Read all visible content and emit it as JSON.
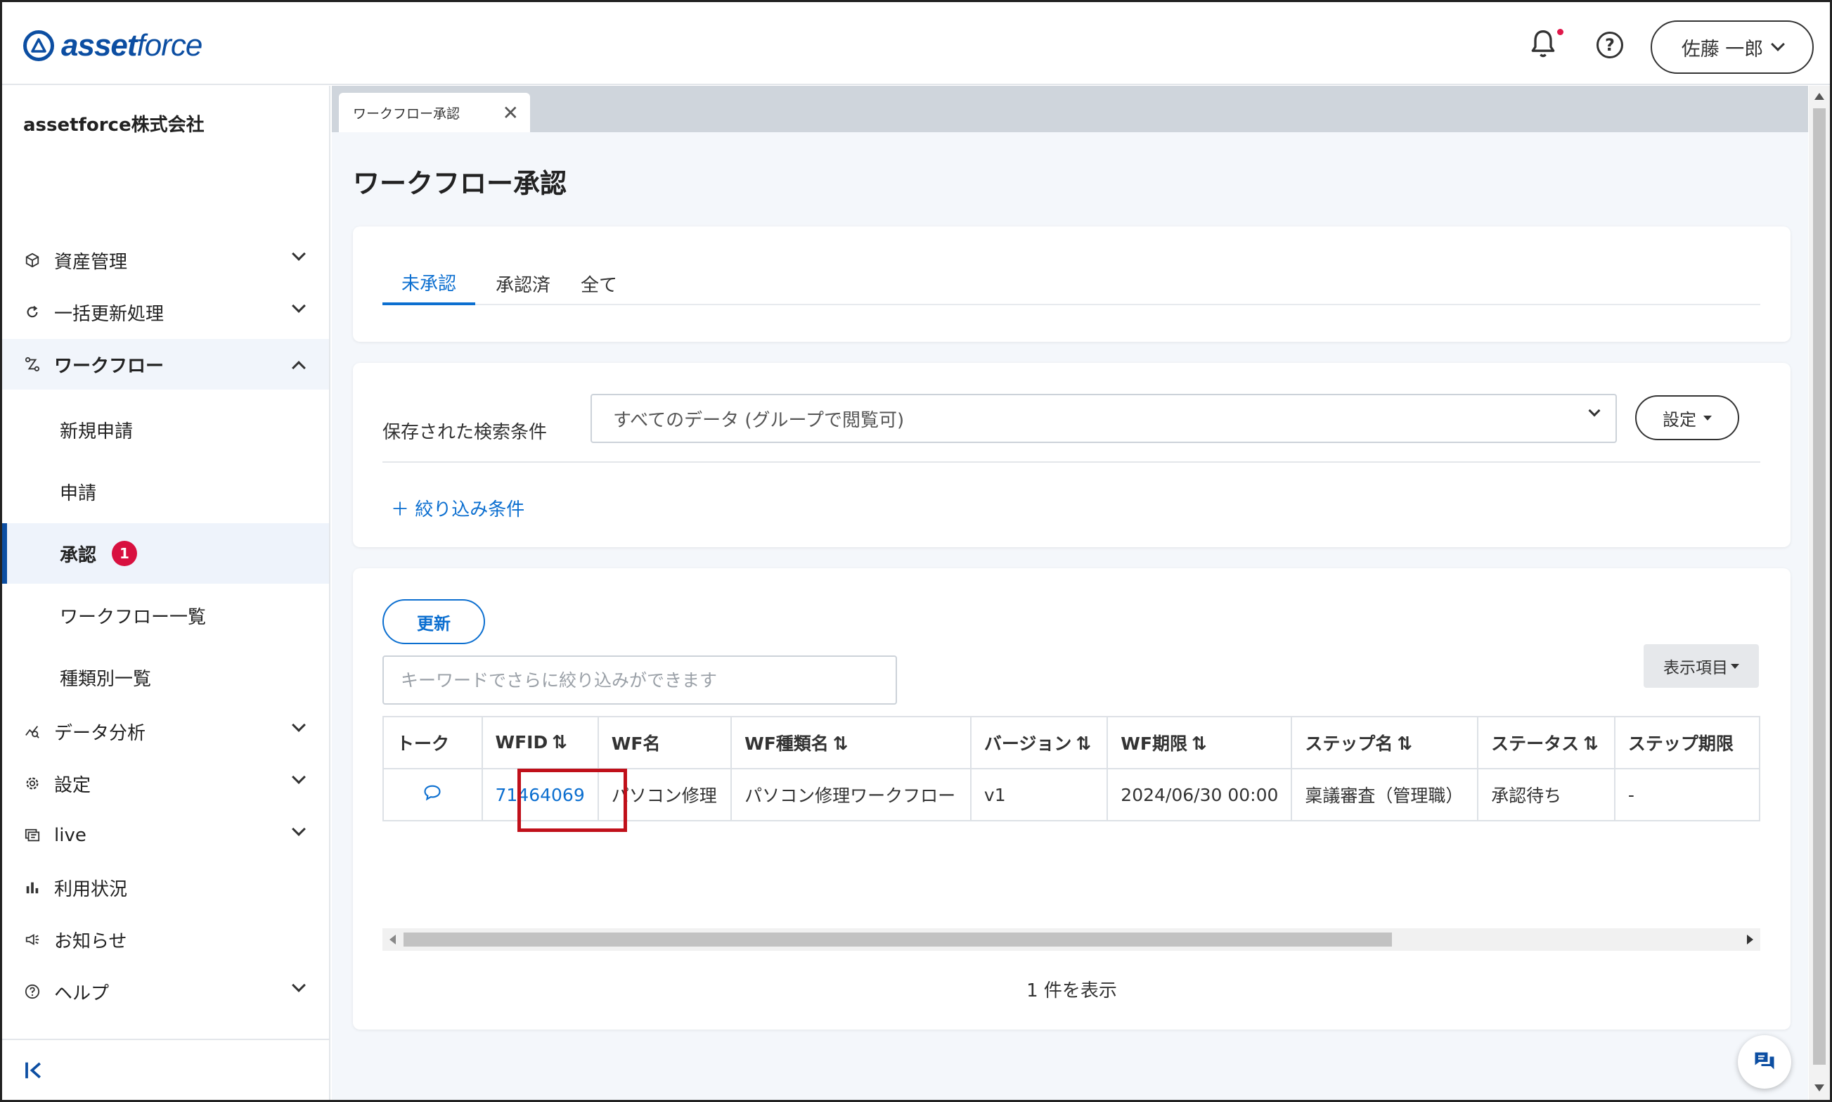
{
  "header": {
    "logo_bold": "asset",
    "logo_light": "force",
    "user_name": "佐藤 一郎",
    "help_glyph": "?"
  },
  "sidebar": {
    "company": "assetforce株式会社",
    "items": [
      {
        "label": "資産管理",
        "icon": "cube-icon"
      },
      {
        "label": "一括更新処理",
        "icon": "refresh-icon"
      },
      {
        "label": "ワークフロー",
        "icon": "workflow-icon"
      },
      {
        "label": "データ分析",
        "icon": "analytics-icon"
      },
      {
        "label": "設定",
        "icon": "gear-icon"
      },
      {
        "label": "live",
        "icon": "live-icon"
      },
      {
        "label": "利用状況",
        "icon": "bar-chart-icon"
      },
      {
        "label": "お知らせ",
        "icon": "megaphone-icon"
      },
      {
        "label": "ヘルプ",
        "icon": "help-circle-icon"
      }
    ],
    "workflow_sub": [
      {
        "label": "新規申請"
      },
      {
        "label": "申請"
      },
      {
        "label": "承認",
        "badge": "1"
      },
      {
        "label": "ワークフロー一覧"
      },
      {
        "label": "種類別一覧"
      }
    ]
  },
  "tabbar": {
    "tab_label": "ワークフロー承認",
    "close_glyph": "✕"
  },
  "page": {
    "title": "ワークフロー承認",
    "filter_tabs": [
      "未承認",
      "承認済",
      "全て"
    ],
    "saved_search_label": "保存された検索条件",
    "saved_search_value": "すべてのデータ (グループで閲覧可)",
    "settings_label": "設定",
    "add_filter_label": "＋ 絞り込み条件",
    "refresh_label": "更新",
    "keyword_placeholder": "キーワードでさらに絞り込みができます",
    "display_items_label": "表示項目"
  },
  "table": {
    "headers": [
      "トーク",
      "WFID",
      "WF名",
      "WF種類名",
      "バージョン",
      "WF期限",
      "ステップ名",
      "ステータス",
      "ステップ期限"
    ],
    "sort_glyph": "⇅",
    "row": {
      "wfid": "71464069",
      "wf_name": "パソコン修理",
      "wf_type": "パソコン修理ワークフロー",
      "version": "v1",
      "deadline": "2024/06/30 00:00",
      "step_name": "稟議審査（管理職）",
      "status": "承認待ち",
      "step_deadline": "-"
    },
    "count_text": "1 件を表示"
  },
  "colors": {
    "brand": "#0c4ea2",
    "link": "#0c6fd0",
    "badge": "#d8103f",
    "highlight": "#c0101a"
  }
}
